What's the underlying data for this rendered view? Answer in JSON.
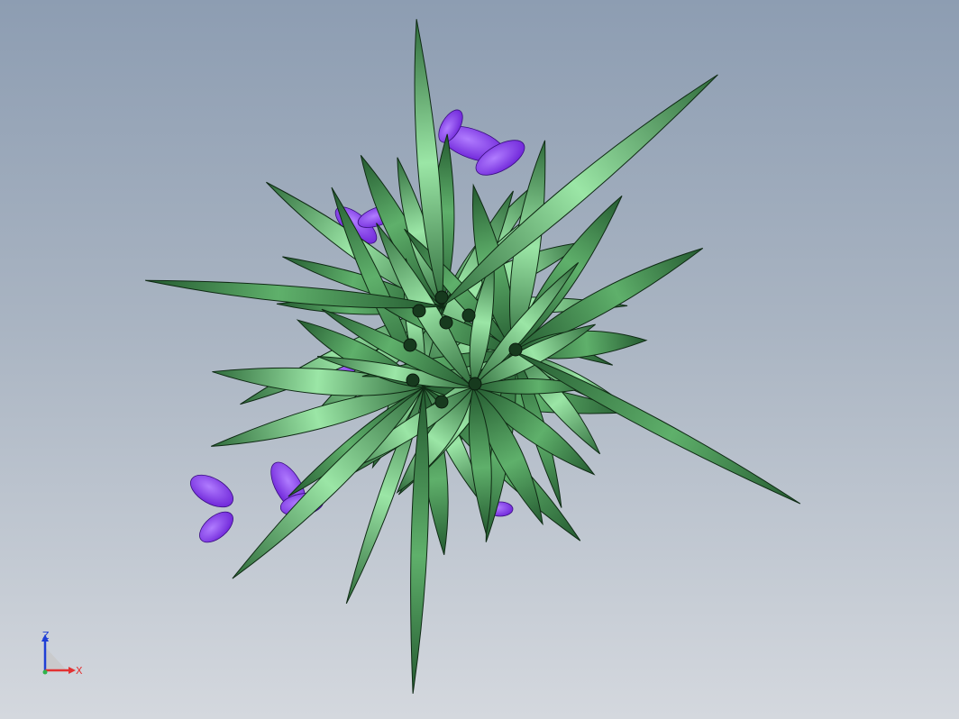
{
  "viewport": {
    "background_top": "#8d9db2",
    "background_bottom": "#d4d8de"
  },
  "model": {
    "leaf_dark": "#2f6b3b",
    "leaf_light": "#9be6a6",
    "petal_color": "#7a2ee6",
    "center_color": "#173a1e"
  },
  "triad": {
    "z_label": "Z",
    "x_label": "X",
    "z_color": "#1f3fd6",
    "x_color": "#e23232"
  }
}
